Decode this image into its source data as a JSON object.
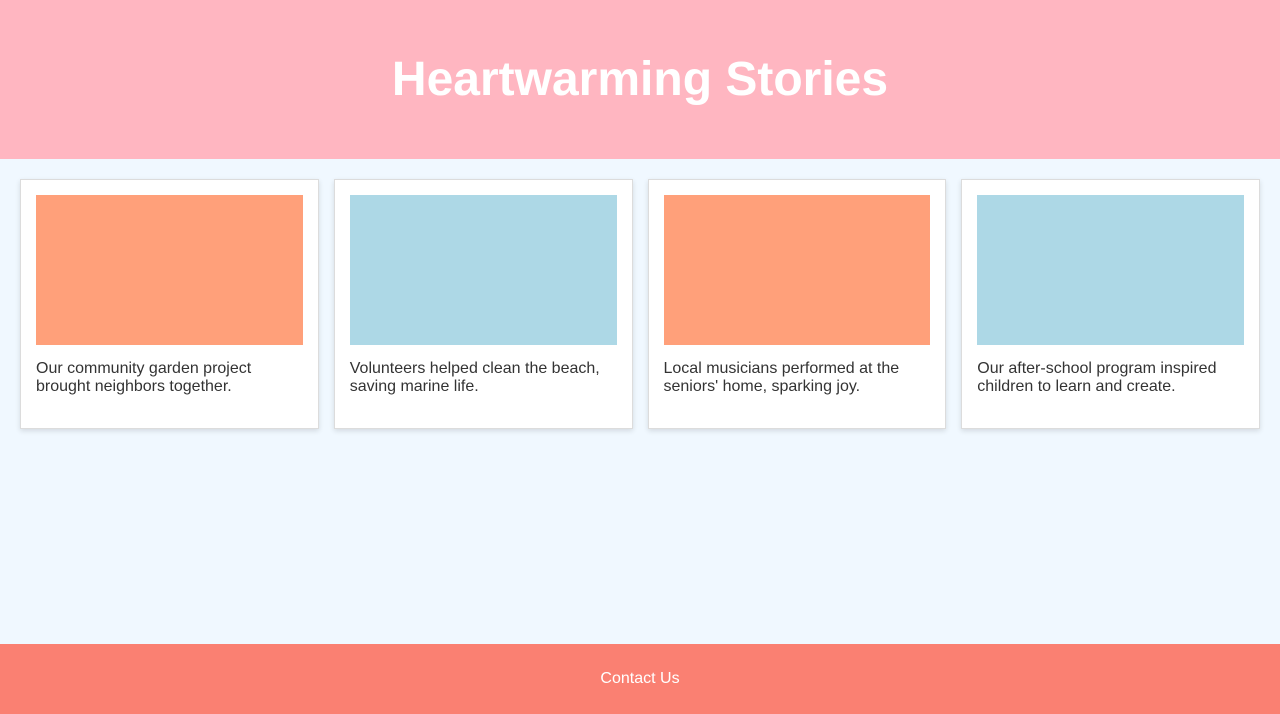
{
  "header": {
    "title": "Heartwarming Stories",
    "background": "#ffb6c1"
  },
  "stories": [
    {
      "text": "Our community garden project brought neighbors together.",
      "thumb_color": "#ffa07a"
    },
    {
      "text": "Volunteers helped clean the beach, saving marine life.",
      "thumb_color": "#add8e6"
    },
    {
      "text": "Local musicians performed at the seniors' home, sparking joy.",
      "thumb_color": "#ffa07a"
    },
    {
      "text": "Our after-school program inspired children to learn and create.",
      "thumb_color": "#add8e6"
    }
  ],
  "footer": {
    "contact_label": "Contact Us",
    "background": "#fa8072"
  }
}
